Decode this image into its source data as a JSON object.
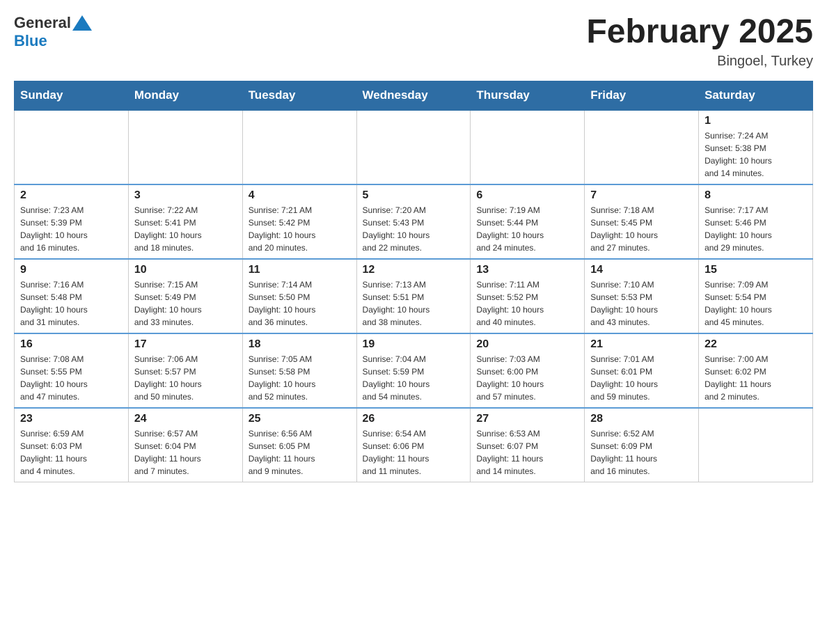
{
  "header": {
    "logo_general": "General",
    "logo_blue": "Blue",
    "main_title": "February 2025",
    "subtitle": "Bingoel, Turkey"
  },
  "calendar": {
    "days_of_week": [
      "Sunday",
      "Monday",
      "Tuesday",
      "Wednesday",
      "Thursday",
      "Friday",
      "Saturday"
    ],
    "weeks": [
      [
        {
          "day": "",
          "info": ""
        },
        {
          "day": "",
          "info": ""
        },
        {
          "day": "",
          "info": ""
        },
        {
          "day": "",
          "info": ""
        },
        {
          "day": "",
          "info": ""
        },
        {
          "day": "",
          "info": ""
        },
        {
          "day": "1",
          "info": "Sunrise: 7:24 AM\nSunset: 5:38 PM\nDaylight: 10 hours\nand 14 minutes."
        }
      ],
      [
        {
          "day": "2",
          "info": "Sunrise: 7:23 AM\nSunset: 5:39 PM\nDaylight: 10 hours\nand 16 minutes."
        },
        {
          "day": "3",
          "info": "Sunrise: 7:22 AM\nSunset: 5:41 PM\nDaylight: 10 hours\nand 18 minutes."
        },
        {
          "day": "4",
          "info": "Sunrise: 7:21 AM\nSunset: 5:42 PM\nDaylight: 10 hours\nand 20 minutes."
        },
        {
          "day": "5",
          "info": "Sunrise: 7:20 AM\nSunset: 5:43 PM\nDaylight: 10 hours\nand 22 minutes."
        },
        {
          "day": "6",
          "info": "Sunrise: 7:19 AM\nSunset: 5:44 PM\nDaylight: 10 hours\nand 24 minutes."
        },
        {
          "day": "7",
          "info": "Sunrise: 7:18 AM\nSunset: 5:45 PM\nDaylight: 10 hours\nand 27 minutes."
        },
        {
          "day": "8",
          "info": "Sunrise: 7:17 AM\nSunset: 5:46 PM\nDaylight: 10 hours\nand 29 minutes."
        }
      ],
      [
        {
          "day": "9",
          "info": "Sunrise: 7:16 AM\nSunset: 5:48 PM\nDaylight: 10 hours\nand 31 minutes."
        },
        {
          "day": "10",
          "info": "Sunrise: 7:15 AM\nSunset: 5:49 PM\nDaylight: 10 hours\nand 33 minutes."
        },
        {
          "day": "11",
          "info": "Sunrise: 7:14 AM\nSunset: 5:50 PM\nDaylight: 10 hours\nand 36 minutes."
        },
        {
          "day": "12",
          "info": "Sunrise: 7:13 AM\nSunset: 5:51 PM\nDaylight: 10 hours\nand 38 minutes."
        },
        {
          "day": "13",
          "info": "Sunrise: 7:11 AM\nSunset: 5:52 PM\nDaylight: 10 hours\nand 40 minutes."
        },
        {
          "day": "14",
          "info": "Sunrise: 7:10 AM\nSunset: 5:53 PM\nDaylight: 10 hours\nand 43 minutes."
        },
        {
          "day": "15",
          "info": "Sunrise: 7:09 AM\nSunset: 5:54 PM\nDaylight: 10 hours\nand 45 minutes."
        }
      ],
      [
        {
          "day": "16",
          "info": "Sunrise: 7:08 AM\nSunset: 5:55 PM\nDaylight: 10 hours\nand 47 minutes."
        },
        {
          "day": "17",
          "info": "Sunrise: 7:06 AM\nSunset: 5:57 PM\nDaylight: 10 hours\nand 50 minutes."
        },
        {
          "day": "18",
          "info": "Sunrise: 7:05 AM\nSunset: 5:58 PM\nDaylight: 10 hours\nand 52 minutes."
        },
        {
          "day": "19",
          "info": "Sunrise: 7:04 AM\nSunset: 5:59 PM\nDaylight: 10 hours\nand 54 minutes."
        },
        {
          "day": "20",
          "info": "Sunrise: 7:03 AM\nSunset: 6:00 PM\nDaylight: 10 hours\nand 57 minutes."
        },
        {
          "day": "21",
          "info": "Sunrise: 7:01 AM\nSunset: 6:01 PM\nDaylight: 10 hours\nand 59 minutes."
        },
        {
          "day": "22",
          "info": "Sunrise: 7:00 AM\nSunset: 6:02 PM\nDaylight: 11 hours\nand 2 minutes."
        }
      ],
      [
        {
          "day": "23",
          "info": "Sunrise: 6:59 AM\nSunset: 6:03 PM\nDaylight: 11 hours\nand 4 minutes."
        },
        {
          "day": "24",
          "info": "Sunrise: 6:57 AM\nSunset: 6:04 PM\nDaylight: 11 hours\nand 7 minutes."
        },
        {
          "day": "25",
          "info": "Sunrise: 6:56 AM\nSunset: 6:05 PM\nDaylight: 11 hours\nand 9 minutes."
        },
        {
          "day": "26",
          "info": "Sunrise: 6:54 AM\nSunset: 6:06 PM\nDaylight: 11 hours\nand 11 minutes."
        },
        {
          "day": "27",
          "info": "Sunrise: 6:53 AM\nSunset: 6:07 PM\nDaylight: 11 hours\nand 14 minutes."
        },
        {
          "day": "28",
          "info": "Sunrise: 6:52 AM\nSunset: 6:09 PM\nDaylight: 11 hours\nand 16 minutes."
        },
        {
          "day": "",
          "info": ""
        }
      ]
    ]
  }
}
